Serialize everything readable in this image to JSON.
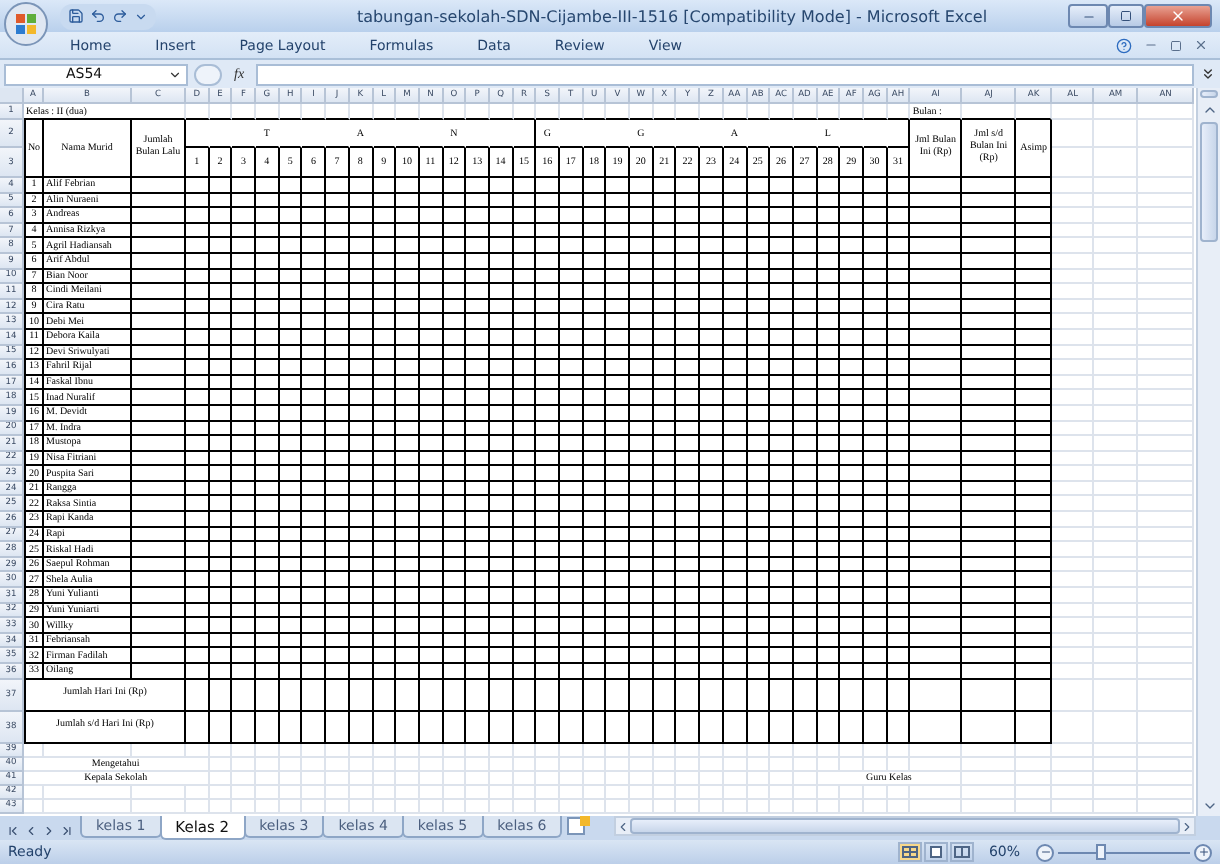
{
  "window": {
    "title": "tabungan-sekolah-SDN-Cijambe-III-1516  [Compatibility Mode] - Microsoft Excel"
  },
  "ribbon_tabs": [
    "Home",
    "Insert",
    "Page Layout",
    "Formulas",
    "Data",
    "Review",
    "View"
  ],
  "formula_bar": {
    "name_box": "AS54",
    "function_label": "fx"
  },
  "columns": [
    "A",
    "B",
    "C",
    "D",
    "E",
    "F",
    "G",
    "H",
    "I",
    "J",
    "K",
    "L",
    "M",
    "N",
    "O",
    "P",
    "Q",
    "R",
    "S",
    "T",
    "U",
    "V",
    "W",
    "X",
    "Y",
    "Z",
    "AA",
    "AB",
    "AC",
    "AD",
    "AE",
    "AF",
    "AG",
    "AH",
    "AI",
    "AJ",
    "AK",
    "AL",
    "AM",
    "AN"
  ],
  "rows": [
    "1",
    "2",
    "3",
    "4",
    "5",
    "6",
    "7",
    "8",
    "9",
    "10",
    "11",
    "12",
    "13",
    "14",
    "15",
    "16",
    "17",
    "18",
    "19",
    "20",
    "21",
    "22",
    "23",
    "24",
    "25",
    "26",
    "27",
    "28",
    "29",
    "30",
    "31",
    "32",
    "33",
    "34",
    "35",
    "36",
    "37",
    "38",
    "39",
    "40",
    "41",
    "42",
    "43"
  ],
  "sheet": {
    "class_label": "Kelas : II (dua)",
    "month_label": "Bulan :",
    "headers": {
      "no": "No",
      "name": "Nama Murid",
      "last_month": "Jumlah Bulan Lalu",
      "this_month": "Jml Bulan Ini (Rp)",
      "to_date": "Jml s/d Bulan Ini (Rp)",
      "asimp": "Asimp"
    },
    "date_letters": [
      "T",
      "A",
      "N",
      "G",
      "G",
      "A",
      "L"
    ],
    "days": [
      "1",
      "2",
      "3",
      "4",
      "5",
      "6",
      "7",
      "8",
      "9",
      "10",
      "11",
      "12",
      "13",
      "14",
      "15",
      "16",
      "17",
      "18",
      "19",
      "20",
      "21",
      "22",
      "23",
      "24",
      "25",
      "26",
      "27",
      "28",
      "29",
      "30",
      "31"
    ],
    "students": [
      {
        "no": "1",
        "name": "Alif Febrian"
      },
      {
        "no": "2",
        "name": "Alin Nuraeni"
      },
      {
        "no": "3",
        "name": "Andreas"
      },
      {
        "no": "4",
        "name": "Annisa Rizkya"
      },
      {
        "no": "5",
        "name": "Agril Hadiansah"
      },
      {
        "no": "6",
        "name": "Arif Abdul"
      },
      {
        "no": "7",
        "name": "Bian Noor"
      },
      {
        "no": "8",
        "name": "Cindi Meilani"
      },
      {
        "no": "9",
        "name": "Cira Ratu"
      },
      {
        "no": "10",
        "name": "Debi Mei"
      },
      {
        "no": "11",
        "name": "Debora Kaila"
      },
      {
        "no": "12",
        "name": "Devi Sriwulyati"
      },
      {
        "no": "13",
        "name": "Fahril Rijal"
      },
      {
        "no": "14",
        "name": "Faskal Ibnu"
      },
      {
        "no": "15",
        "name": "Inad Nuralif"
      },
      {
        "no": "16",
        "name": "M. Devidt"
      },
      {
        "no": "17",
        "name": "M. Indra"
      },
      {
        "no": "18",
        "name": "Mustopa"
      },
      {
        "no": "19",
        "name": "Nisa Fitriani"
      },
      {
        "no": "20",
        "name": "Puspita Sari"
      },
      {
        "no": "21",
        "name": "Rangga"
      },
      {
        "no": "22",
        "name": "Raksa Sintia"
      },
      {
        "no": "23",
        "name": "Rapi Kanda"
      },
      {
        "no": "24",
        "name": "Rapi"
      },
      {
        "no": "25",
        "name": "Riskal Hadi"
      },
      {
        "no": "26",
        "name": "Saepul Rohman"
      },
      {
        "no": "27",
        "name": "Shela Aulia"
      },
      {
        "no": "28",
        "name": "Yuni Yulianti"
      },
      {
        "no": "29",
        "name": "Yuni Yuniarti"
      },
      {
        "no": "30",
        "name": "Willky"
      },
      {
        "no": "31",
        "name": "Febriansah"
      },
      {
        "no": "32",
        "name": "Firman Fadilah"
      },
      {
        "no": "33",
        "name": "Oilang"
      }
    ],
    "totals": [
      "Jumlah Hari Ini (Rp)",
      "Jumlah s/d Hari Ini (Rp)"
    ],
    "signatures": {
      "acknowledged": "Mengetahui",
      "principal": "Kepala Sekolah",
      "teacher": "Guru Kelas"
    }
  },
  "sheet_tabs": [
    {
      "label": "kelas 1",
      "selected": false
    },
    {
      "label": "Kelas 2",
      "selected": true
    },
    {
      "label": "kelas 3",
      "selected": false
    },
    {
      "label": "kelas 4",
      "selected": false
    },
    {
      "label": "kelas 5",
      "selected": false
    },
    {
      "label": "kelas 6",
      "selected": false
    }
  ],
  "status_bar": {
    "status": "Ready",
    "zoom": "60%",
    "zoom_slider": {
      "level": 0.32
    }
  }
}
